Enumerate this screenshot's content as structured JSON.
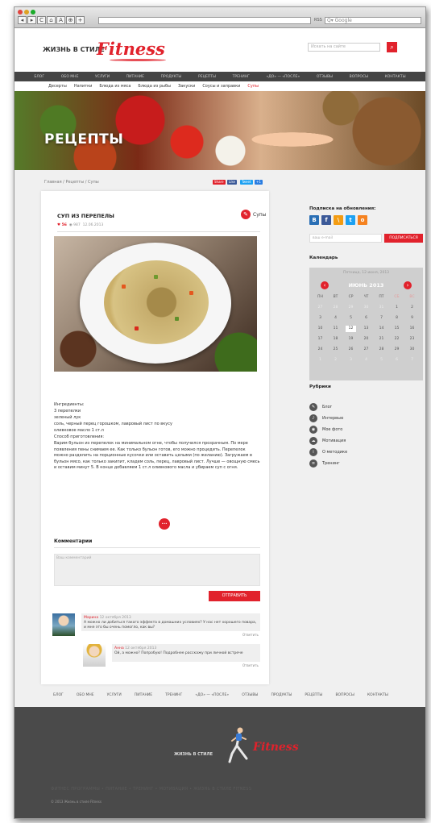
{
  "browser": {
    "search_placeholder": "Q▾ Google",
    "nav_buttons": [
      "◂",
      "▸",
      "C",
      "⌂",
      "A",
      "⊕",
      "+"
    ],
    "badge": "RSS"
  },
  "header": {
    "logo_text": "ЖИЗНЬ В СТИЛЕ",
    "logo_brand": "Fitness",
    "search_placeholder": "Искать на сайте",
    "search_button": "⌕"
  },
  "main_nav": [
    "БЛОГ",
    "ОБО МНЕ",
    "УСЛУГИ",
    "ПИТАНИЕ",
    "ПРОДУКТЫ",
    "РЕЦЕПТЫ",
    "ТРЕНИНГ",
    "«ДО» — «ПОСЛЕ»",
    "ОТЗЫВЫ",
    "ВОПРОСЫ",
    "КОНТАКТЫ"
  ],
  "sub_nav": [
    {
      "label": "Десерты",
      "active": false
    },
    {
      "label": "Напитки",
      "active": false
    },
    {
      "label": "Блюда из мяса",
      "active": false
    },
    {
      "label": "Блюда из рыбы",
      "active": false
    },
    {
      "label": "Закуски",
      "active": false
    },
    {
      "label": "Соусы и заправки",
      "active": false
    },
    {
      "label": "Супы",
      "active": true
    }
  ],
  "banner": {
    "title": "РЕЦЕПТЫ"
  },
  "breadcrumb": "Главная / Рецепты / Супы",
  "share_buttons": [
    {
      "label": "Share",
      "color": "#e1222c"
    },
    {
      "label": "Like",
      "color": "#3b5998"
    },
    {
      "label": "Tweet",
      "color": "#1da1f2"
    },
    {
      "label": "+1",
      "color": "#2a7de1"
    }
  ],
  "recipe": {
    "title": "СУП ИЗ ПЕРЕПЕЛЫ",
    "likes": "♥ 56",
    "views": "◉ 987",
    "date": "12.06.2013",
    "category": "Супы",
    "category_icon": "soup-icon",
    "ingredients_title": "Ингредиенты:",
    "ingredients": [
      "3 перепелки",
      "зеленый лук",
      "соль, черный перец горошком, лавровый лист по вкусу",
      "оливковое масло 1 ст.л"
    ],
    "method_title": "Способ приготовления:",
    "method_text": "Варим бульон из перепелок на минимальном огне, чтобы получился прозрачным. По мере появления пены снимаем ее. Как только бульон готов, его можно процедить. Перепелок можно разделить на порционные кусочки или оставить целыми (по желанию). Загружаем в бульон мясо, как только закипит, кладем соль, перец, лавровый лист. Лучше — овощную смесь и оставим минут 5. В конце добавляем 1 ст.л оливкового масла и убираем суп с огня.",
    "more_label": "•••"
  },
  "comments": {
    "title": "Комментарии",
    "placeholder": "Ваш комментарий",
    "submit": "ОТПРАВИТЬ",
    "items": [
      {
        "name": "Марина",
        "date": "12 октября 2013",
        "text": "А можно ли добиться такого эффекта в домашних условиях? У нас нет хорошего повара, и мне это бы очень помогло, как вы?",
        "reply": "Ответить"
      },
      {
        "name": "Анна",
        "date": "12 октября 2013",
        "text": "Ой, а можно? Попробую! Подробнее расскажу при личной встрече",
        "reply": "Ответить"
      }
    ]
  },
  "sidebar": {
    "subscribe_title": "Подписка на обновления:",
    "social": [
      {
        "label": "B",
        "color": "#2a6fb5",
        "icon": "vk-icon"
      },
      {
        "label": "f",
        "color": "#3b5998",
        "icon": "facebook-icon"
      },
      {
        "label": "\\",
        "color": "#f39c12",
        "icon": "rss-icon"
      },
      {
        "label": "t",
        "color": "#1da1f2",
        "icon": "twitter-icon"
      },
      {
        "label": "o",
        "color": "#f58220",
        "icon": "odnoklassniki-icon"
      }
    ],
    "email_placeholder": "ваш e-mail",
    "subscribe_button": "ПОДПИСАТЬСЯ",
    "calendar_title": "Календарь",
    "calendar_today": "Пятница, 12 июня, 2013",
    "calendar_month": "ИЮНЬ 2013",
    "calendar_weekdays": [
      "ПН",
      "ВТ",
      "СР",
      "ЧТ",
      "ПТ",
      "СБ",
      "ВС"
    ],
    "calendar_days": [
      "27",
      "28",
      "29",
      "30",
      "31",
      "1",
      "2",
      "3",
      "4",
      "5",
      "6",
      "7",
      "8",
      "9",
      "10",
      "11",
      "12",
      "13",
      "14",
      "15",
      "16",
      "17",
      "18",
      "19",
      "20",
      "21",
      "22",
      "23",
      "24",
      "25",
      "26",
      "27",
      "28",
      "29",
      "30",
      "1",
      "2",
      "3",
      "4",
      "5",
      "6",
      "7"
    ],
    "calendar_current": "12",
    "rubrics_title": "Рубрики",
    "rubrics": [
      {
        "label": "Блог",
        "icon": "pencil-icon"
      },
      {
        "label": "Интервью",
        "icon": "mic-icon"
      },
      {
        "label": "Мое фото",
        "icon": "camera-icon"
      },
      {
        "label": "Мотивация",
        "icon": "cloud-icon"
      },
      {
        "label": "О методике",
        "icon": "info-icon"
      },
      {
        "label": "Тренинг",
        "icon": "dumbbell-icon"
      }
    ]
  },
  "footer": {
    "nav": [
      "БЛОГ",
      "ОБО МНЕ",
      "УСЛУГИ",
      "ПИТАНИЕ",
      "ТРЕНИНГ",
      "«ДО» — «ПОСЛЕ»",
      "ОТЗЫВЫ",
      "ПРОДУКТЫ",
      "РЕЦЕПТЫ",
      "ВОПРОСЫ",
      "КОНТАКТЫ"
    ],
    "logo_text": "ЖИЗНЬ В СТИЛЕ",
    "logo_brand": "Fitness",
    "tagline": "ФИТНЕС ПРОГРАММЫ • ПИТАНИЕ • ТРЕНИНГ • МОТИВАЦИЯ • ЖИЗНЬ В СТИЛЕ FITNESS",
    "copyright": "© 2013 Жизнь в стиле Fitness"
  }
}
